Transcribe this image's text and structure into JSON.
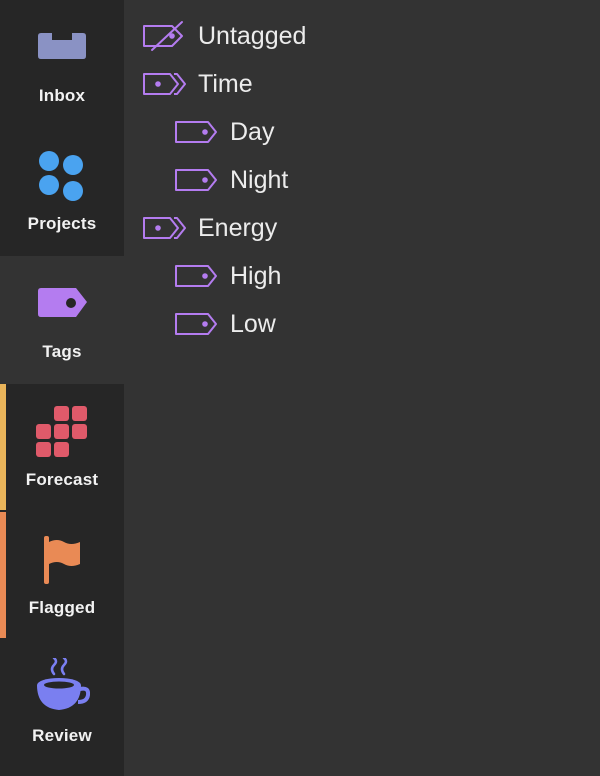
{
  "sidebar": {
    "items": [
      {
        "label": "Inbox",
        "icon": "inbox-icon"
      },
      {
        "label": "Projects",
        "icon": "projects-icon"
      },
      {
        "label": "Tags",
        "icon": "tag-icon",
        "selected": true
      },
      {
        "label": "Forecast",
        "icon": "forecast-icon",
        "accent": "#e9b45a"
      },
      {
        "label": "Flagged",
        "icon": "flag-icon",
        "accent": "#e98a55"
      },
      {
        "label": "Review",
        "icon": "coffee-cup-icon"
      }
    ]
  },
  "tags": {
    "items": [
      {
        "label": "Untagged",
        "icon": "untagged-icon"
      },
      {
        "label": "Time",
        "icon": "tag-group-icon"
      },
      {
        "label": "Day",
        "icon": "tag-icon"
      },
      {
        "label": "Night",
        "icon": "tag-icon"
      },
      {
        "label": "Energy",
        "icon": "tag-group-icon"
      },
      {
        "label": "High",
        "icon": "tag-icon"
      },
      {
        "label": "Low",
        "icon": "tag-icon"
      }
    ]
  },
  "colors": {
    "tag_purple": "#b47cf0",
    "inbox": "#8a92c4",
    "projects": "#4aa3f0",
    "forecast": "#e05a6a",
    "flagged": "#e98a55",
    "review": "#7a7ff0",
    "forecast_accent": "#e9b45a",
    "flagged_accent": "#e98a55"
  }
}
